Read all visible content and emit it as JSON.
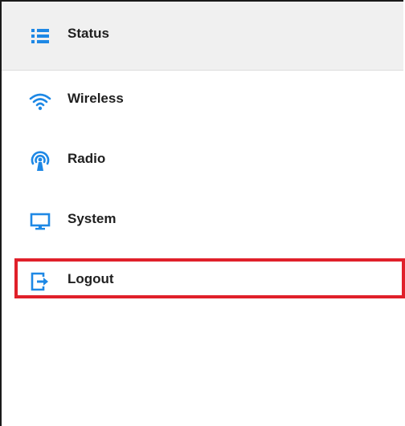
{
  "nav": {
    "items": [
      {
        "label": "Status",
        "icon": "list-icon"
      },
      {
        "label": "Wireless",
        "icon": "wifi-icon"
      },
      {
        "label": "Radio",
        "icon": "radio-antenna-icon"
      },
      {
        "label": "System",
        "icon": "monitor-icon"
      },
      {
        "label": "Logout",
        "icon": "logout-icon"
      }
    ],
    "active_item": "Status",
    "highlighted_item": "Logout"
  },
  "colors": {
    "icon_blue": "#1e88e5",
    "active_bg": "#f0f0f0",
    "highlight_border": "#e0202a",
    "label_text": "#1f1f1f"
  }
}
